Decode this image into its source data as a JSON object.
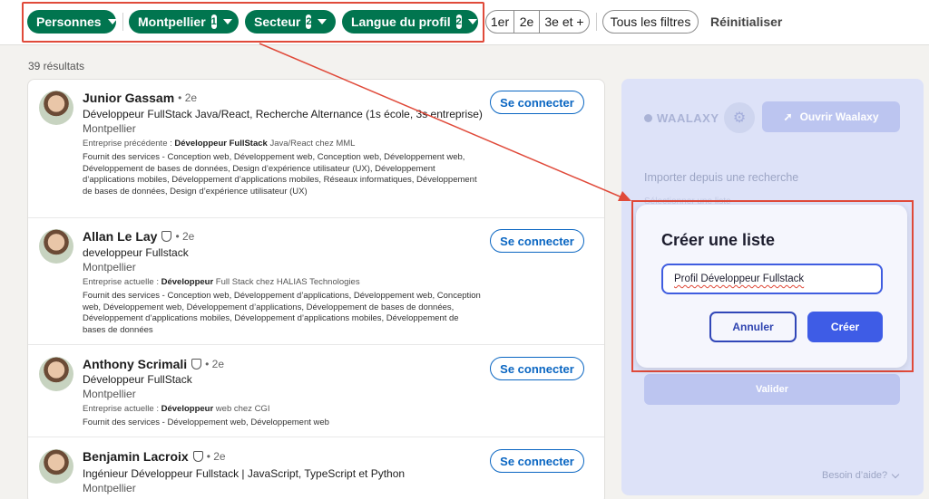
{
  "filters": {
    "personnes": "Personnes",
    "montpellier": "Montpellier",
    "montpellier_count": "1",
    "secteur": "Secteur",
    "secteur_count": "2",
    "langue": "Langue du profil",
    "langue_count": "2",
    "degree_1": "1er",
    "degree_2": "2e",
    "degree_3": "3e et +",
    "all_filters": "Tous les filtres",
    "reset": "Réinitialiser"
  },
  "results_count": "39 résultats",
  "results": [
    {
      "name": "Junior Gassam",
      "degree": "• 2e",
      "headline": "Développeur FullStack Java/React, Recherche Alternance (1s école, 3s entreprise)",
      "location": "Montpellier",
      "position_prefix": "Entreprise précédente : ",
      "position_bold": "Développeur FullStack",
      "position_suffix": " Java/React chez MML",
      "services_prefix": "Fournit des services - ",
      "services": "Conception web, Développement web, Conception web, Développement web, Développement de bases de données, Design d’expérience utilisateur (UX), Développement d’applications mobiles, Développement d’applications mobiles, Réseaux informatiques, Développement de bases de données, Design d’expérience utilisateur (UX)",
      "connect": "Se connecter"
    },
    {
      "name": "Allan Le Lay",
      "degree": "• 2e",
      "headline": "developpeur Fullstack",
      "location": "Montpellier",
      "position_prefix": "Entreprise actuelle : ",
      "position_bold": "Développeur",
      "position_suffix": " Full Stack chez HALIAS Technologies",
      "services_prefix": "Fournit des services - ",
      "services": "Conception web, Développement d’applications, Développement web, Conception web, Développement web, Développement d’applications, Développement de bases de données, Développement d’applications mobiles, Développement d’applications mobiles, Développement de bases de données",
      "connect": "Se connecter"
    },
    {
      "name": "Anthony Scrimali",
      "degree": "• 2e",
      "headline": "Développeur FullStack",
      "location": "Montpellier",
      "position_prefix": "Entreprise actuelle : ",
      "position_bold": "Développeur",
      "position_suffix": " web chez CGI",
      "services_prefix": "Fournit des services - ",
      "services": "Développement web, Développement web",
      "connect": "Se connecter"
    },
    {
      "name": "Benjamin Lacroix",
      "degree": "• 2e",
      "headline": "Ingénieur Développeur Fullstack | JavaScript, TypeScript et Python",
      "location": "Montpellier",
      "connect": "Se connecter"
    }
  ],
  "waalaxy": {
    "logo": "WAALAXY",
    "open_button": "Ouvrir Waalaxy",
    "import_label": "Importer depuis une recherche",
    "select_placeholder": "Sélectionner une liste",
    "valider": "Valider",
    "help": "Besoin d’aide?"
  },
  "modal": {
    "title": "Créer une liste",
    "input_value": "Profil Développeur Fullstack",
    "cancel": "Annuler",
    "create": "Créer"
  },
  "colors": {
    "linkedin_green": "#01754f",
    "linkedin_blue": "#0a66c2",
    "waalaxy_blue": "#3e5ce6",
    "highlight_red": "#e04a3a"
  }
}
